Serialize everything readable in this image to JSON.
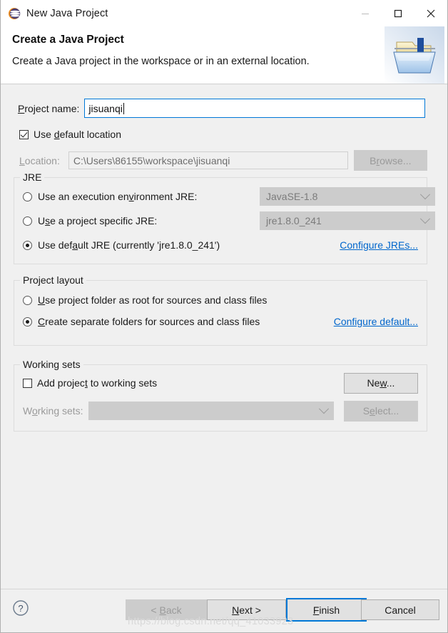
{
  "window": {
    "title": "New Java Project",
    "app_icon": "eclipse-icon",
    "controls": {
      "minimize": "minimize-icon",
      "maximize": "maximize-icon",
      "close": "close-icon"
    }
  },
  "header": {
    "title": "Create a Java Project",
    "description": "Create a Java project in the workspace or in an external location.",
    "icon": "java-project-folder-icon"
  },
  "form": {
    "project_name_label": "Project name:",
    "project_name_value": "jisuanqi",
    "project_name_placeholder": "",
    "use_default_location_label": "Use default location",
    "use_default_location_checked": true,
    "location_label": "Location:",
    "location_value": "C:\\Users\\86155\\workspace\\jisuanqi",
    "browse_label": "Browse..."
  },
  "jre": {
    "group_title": "JRE",
    "options": [
      {
        "label": "Use an execution environment JRE:",
        "selected": false,
        "combo_value": "JavaSE-1.8"
      },
      {
        "label": "Use a project specific JRE:",
        "selected": false,
        "combo_value": "jre1.8.0_241"
      },
      {
        "label": "Use default JRE (currently 'jre1.8.0_241')",
        "selected": true
      }
    ],
    "configure_link": "Configure JREs..."
  },
  "layout": {
    "group_title": "Project layout",
    "options": [
      {
        "label": "Use project folder as root for sources and class files",
        "selected": false
      },
      {
        "label": "Create separate folders for sources and class files",
        "selected": true
      }
    ],
    "configure_link": "Configure default..."
  },
  "working_sets": {
    "group_title": "Working sets",
    "add_label": "Add project to working sets",
    "add_checked": false,
    "new_label": "New...",
    "sets_label": "Working sets:",
    "sets_value": "",
    "select_label": "Select..."
  },
  "footer": {
    "help_icon": "help-icon",
    "back_label": "< Back",
    "next_label": "Next >",
    "finish_label": "Finish",
    "cancel_label": "Cancel"
  },
  "watermark": {
    "text": "https://blog.csdn.net/qq_41033923"
  },
  "colors": {
    "accent_blue": "#0078d7",
    "link_blue": "#0066cc",
    "dialog_bg": "#f0f0f0",
    "disabled_gray": "#cccccc"
  }
}
